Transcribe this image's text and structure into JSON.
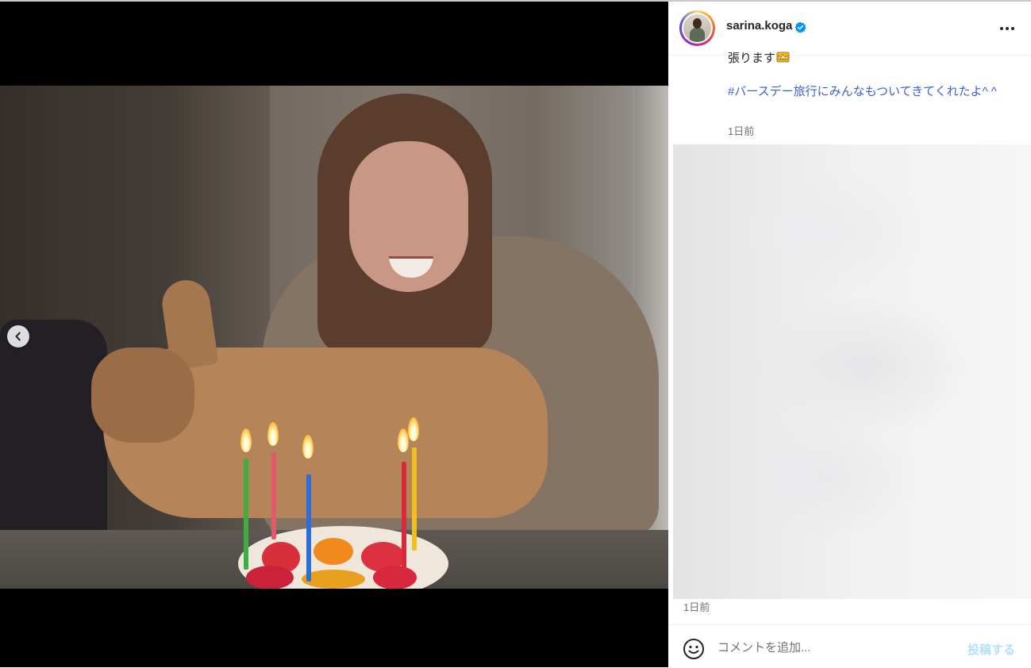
{
  "post": {
    "username": "sarina.koga",
    "verified": true,
    "caption_tail": "張ります",
    "caption_emoji": "crown-emoji",
    "hashtag": "#バースデー旅行にみんなもついてきてくれたよ^ ^",
    "timestamp_caption": "1日前",
    "timestamp_post": "1日前"
  },
  "comment": {
    "placeholder": "コメントを追加...",
    "post_label": "投稿する"
  },
  "colors": {
    "link": "#3a5fd8",
    "verified": "#0095f6",
    "post_disabled": "#b2dffc",
    "muted_text": "#737373"
  },
  "icons": {
    "prev": "chevron-left-icon",
    "more": "more-options-icon",
    "emoji": "smiley-icon",
    "verified": "verified-badge-icon"
  }
}
